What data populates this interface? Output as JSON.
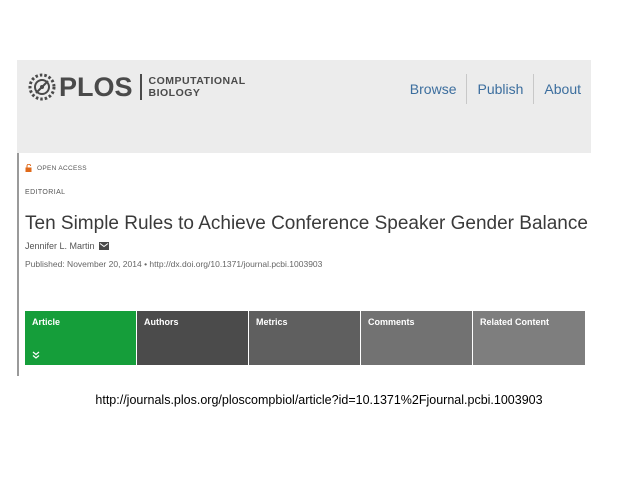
{
  "logo": {
    "wordmark": "PLOS",
    "sub_line1": "COMPUTATIONAL",
    "sub_line2": "BIOLOGY"
  },
  "nav": {
    "items": [
      "Browse",
      "Publish",
      "About"
    ]
  },
  "article": {
    "access_label": "OPEN ACCESS",
    "type_label": "EDITORIAL",
    "title": "Ten Simple Rules to Achieve Conference Speaker Gender Balance",
    "author": "Jennifer L. Martin",
    "published": "Published: November 20, 2014 • http://dx.doi.org/10.1371/journal.pcbi.1003903"
  },
  "tabs": {
    "items": [
      "Article",
      "Authors",
      "Metrics",
      "Comments",
      "Related Content"
    ],
    "active_color": "#159e3a"
  },
  "caption": "http://journals.plos.org/ploscompbiol/article?id=10.1371%2Fjournal.pcbi.1003903",
  "colors": {
    "nav_link": "#3c6e9e",
    "header_bg": "#ececec",
    "logo_text": "#4a4a4a"
  }
}
